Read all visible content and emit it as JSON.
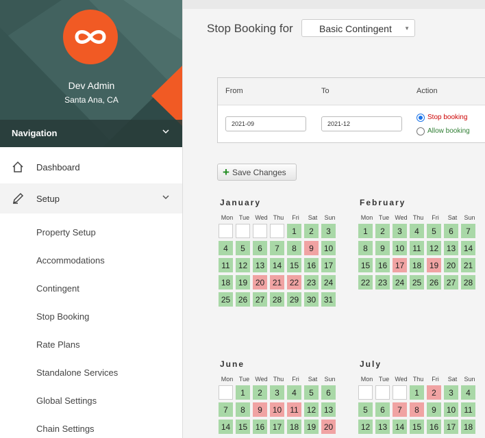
{
  "user": {
    "name": "Dev Admin",
    "location": "Santa Ana, CA"
  },
  "nav": {
    "header": "Navigation",
    "dashboard": "Dashboard",
    "setup": "Setup",
    "sub_items": [
      "Property Setup",
      "Accommodations",
      "Contingent",
      "Stop Booking",
      "Rate Plans",
      "Standalone Services",
      "Global Settings",
      "Chain Settings"
    ]
  },
  "page": {
    "title": "Stop Booking for",
    "contingent_select": "Basic Contingent"
  },
  "range": {
    "from_label": "From",
    "to_label": "To",
    "action_label": "Action",
    "from_value": "2021-09",
    "to_value": "2021-12",
    "stop_label": "Stop booking",
    "allow_label": "Allow booking",
    "stop_color": "#cc0000",
    "allow_color": "#2e7d32"
  },
  "save_label": "Save Changes",
  "weekdays": [
    "Mon",
    "Tue",
    "Wed",
    "Thu",
    "Fri",
    "Sat",
    "Sun"
  ],
  "status_colors": {
    "available": "#a9d8a7",
    "stopped": "#f0a3a3"
  },
  "months": [
    {
      "name": "January",
      "offset": 4,
      "days": 31,
      "stopped": [
        9,
        20,
        21,
        22
      ]
    },
    {
      "name": "February",
      "offset": 0,
      "days": 28,
      "stopped": [
        17,
        19
      ]
    },
    {
      "name": "June",
      "offset": 1,
      "days": 20,
      "stopped": [
        9,
        10,
        11,
        20
      ]
    },
    {
      "name": "July",
      "offset": 3,
      "days": 18,
      "stopped": [
        2,
        7,
        8
      ]
    }
  ]
}
